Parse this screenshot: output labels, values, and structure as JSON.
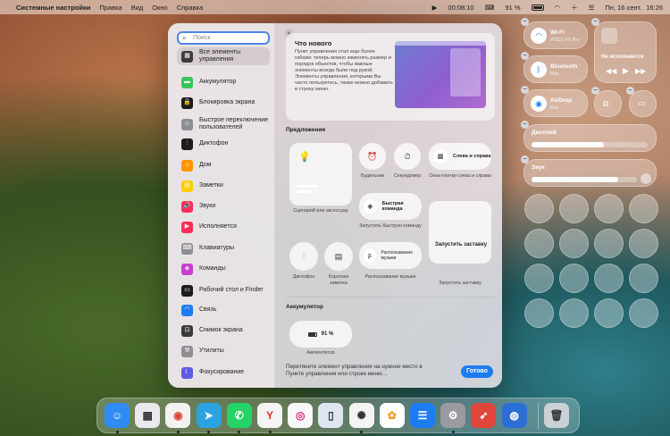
{
  "menubar": {
    "apple": "",
    "app": "Системные настройки",
    "items": [
      "Правка",
      "Вид",
      "Окно",
      "Справка"
    ],
    "time_elapsed": "00:08:10",
    "battery": "91 %",
    "date": "Пн, 16 сент.",
    "clock": "16:26"
  },
  "search": {
    "placeholder": "Поиск"
  },
  "sidebar": {
    "items": [
      {
        "label": "Все элементы управления",
        "color": "#3a3a3c",
        "icon": "grid-icon"
      },
      {
        "label": "Аккумулятор",
        "color": "#34c759",
        "icon": "battery-icon"
      },
      {
        "label": "Блокировка экрана",
        "color": "#1c1c1e",
        "icon": "lock-icon"
      },
      {
        "label": "Быстрое переключение пользователей",
        "color": "#8e8e93",
        "icon": "user-icon"
      },
      {
        "label": "Диктофон",
        "color": "#1c1c1e",
        "icon": "waveform-icon"
      },
      {
        "label": "Дом",
        "color": "#ff9500",
        "icon": "home-icon"
      },
      {
        "label": "Заметки",
        "color": "#ffcc00",
        "icon": "notes-icon"
      },
      {
        "label": "Звуки",
        "color": "#ff2d55",
        "icon": "speaker-icon"
      },
      {
        "label": "Исполняется",
        "color": "#ff2d55",
        "icon": "play-icon"
      },
      {
        "label": "Клавиатуры",
        "color": "#8e8e93",
        "icon": "keyboard-icon"
      },
      {
        "label": "Команды",
        "color": "#c53ed1",
        "icon": "shortcuts-icon"
      },
      {
        "label": "Рабочий стол и Finder",
        "color": "#1c1c1e",
        "icon": "desktop-icon"
      },
      {
        "label": "Связь",
        "color": "#1e7cf2",
        "icon": "wifi-icon"
      },
      {
        "label": "Снимок экрана",
        "color": "#3a3a3c",
        "icon": "screenshot-icon"
      },
      {
        "label": "Утилиты",
        "color": "#8e8e93",
        "icon": "utilities-icon"
      },
      {
        "label": "Фокусирование",
        "color": "#5e5ce6",
        "icon": "moon-icon"
      }
    ]
  },
  "whats_new": {
    "title": "Что нового",
    "body": "Пункт управления стал еще более гибким: теперь можно изменять размер и порядок объектов, чтобы важные элементы всегда были под рукой. Элементы управления, которыми Вы часто пользуетесь, также можно добавить в строку меню."
  },
  "suggestions": {
    "title": "Предложения",
    "scenario_caption": "Сценарий или аксессуар",
    "alarms": "Будильник",
    "stopwatch": "Секундомер",
    "windows_label": "Слева и справа",
    "windows_caption": "Окна-плитки слева и справа",
    "quick_cmd_label": "Быстрая команда",
    "quick_cmd_caption": "Запустить быструю команду",
    "screensaver_label": "Запустить заставку",
    "screensaver_caption": "Запустить заставку",
    "dictaphone": "Диктофон",
    "quick_note": "Короткая заметка",
    "music_recog_label": "Распознавание музыки",
    "music_recog_caption": "Распознавание музыки"
  },
  "battery_section": {
    "title": "Аккумулятор",
    "value": "91 %",
    "caption": "Аккумулятор"
  },
  "footer": {
    "text": "Перетяните элемент управления на нужное место в Пункте управления или строке меню…",
    "done": "Готово"
  },
  "control_center": {
    "wifi_label": "Wi-Fi",
    "wifi_sub": "POCO F5 Pro",
    "bluetooth_label": "Bluetooth",
    "bluetooth_sub": "Вкл.",
    "airdrop_label": "AirDrop",
    "airdrop_sub": "Все",
    "now_playing": "Не исполняется",
    "display_label": "Дисплей",
    "display_level": 0.62,
    "sound_label": "Звук",
    "sound_level": 0.82
  },
  "dock": {
    "apps": [
      {
        "name": "finder-icon",
        "color": "#2f8cf5",
        "glyph": "☺"
      },
      {
        "name": "launchpad-icon",
        "color": "#e9e9ee",
        "glyph": "▦"
      },
      {
        "name": "chrome-icon",
        "color": "#f2f2f2",
        "glyph": "◉"
      },
      {
        "name": "telegram-icon",
        "color": "#2aa3e0",
        "glyph": "➤"
      },
      {
        "name": "whatsapp-icon",
        "color": "#25d366",
        "glyph": "✆"
      },
      {
        "name": "yandex-icon",
        "color": "#f4f4f4",
        "glyph": "Y"
      },
      {
        "name": "instagram-icon",
        "color": "#f8f8f8",
        "glyph": "◎"
      },
      {
        "name": "iphone-mirroring-icon",
        "color": "#dfe6f2",
        "glyph": "▯"
      },
      {
        "name": "chatgpt-icon",
        "color": "#f4f4f4",
        "glyph": "✺"
      },
      {
        "name": "photos-icon",
        "color": "#ffffff",
        "glyph": "✿"
      },
      {
        "name": "network-icon",
        "color": "#1e7cf2",
        "glyph": "☰"
      },
      {
        "name": "settings-icon",
        "color": "#9a9aa0",
        "glyph": "⚙"
      },
      {
        "name": "rocket-icon",
        "color": "#e0453a",
        "glyph": "➶"
      },
      {
        "name": "disk-icon",
        "color": "#2b6fd6",
        "glyph": "◍"
      },
      {
        "name": "trash-icon",
        "color": "#c9d1d6",
        "glyph": "🗑"
      }
    ]
  }
}
